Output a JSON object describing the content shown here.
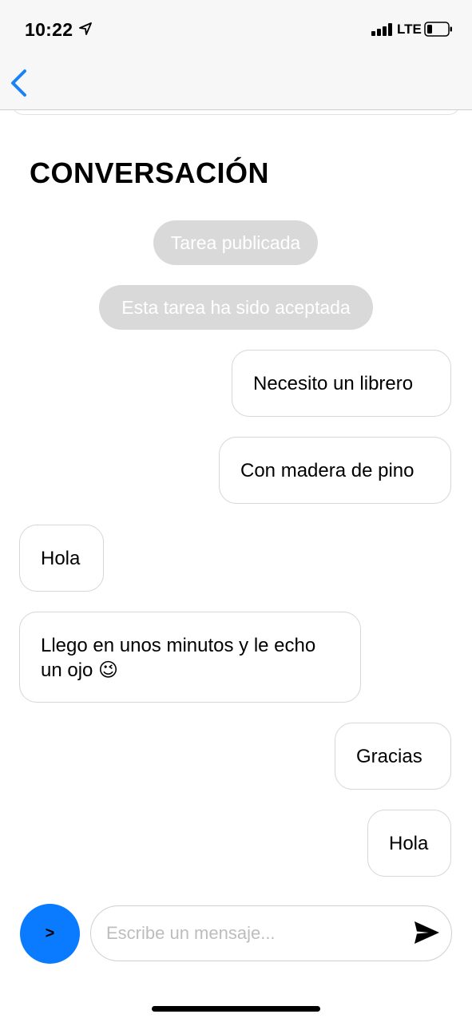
{
  "status_bar": {
    "time": "10:22",
    "network": "LTE"
  },
  "nav": {
    "back_icon": "chevron-left-icon"
  },
  "page": {
    "title": "CONVERSACIÓN"
  },
  "system_messages": [
    {
      "text": "Tarea publicada"
    },
    {
      "text": "Esta tarea ha sido aceptada"
    }
  ],
  "messages": [
    {
      "side": "right",
      "text": "Necesito un librero"
    },
    {
      "side": "right",
      "text": "Con madera de pino"
    },
    {
      "side": "left",
      "text": "Hola"
    },
    {
      "side": "left",
      "text": "Llego en unos minutos y le echo un ojo 😉"
    },
    {
      "side": "right",
      "text": "Gracias"
    },
    {
      "side": "right",
      "text": "Hola"
    }
  ],
  "composer": {
    "fab_label": ">",
    "placeholder": "Escribe un mensaje...",
    "value": "",
    "send_icon": "send-icon"
  },
  "colors": {
    "accent": "#0a7bff",
    "pill_bg": "#d9d9d9",
    "bubble_border": "#d6d6d6",
    "back_icon": "#1a82f7"
  }
}
